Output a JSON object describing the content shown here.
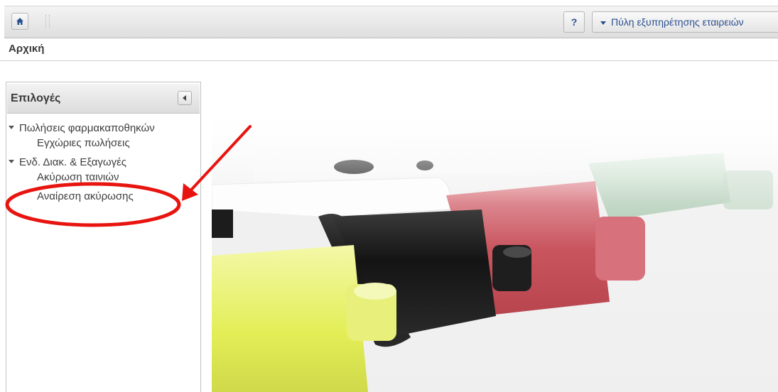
{
  "toolbar": {
    "home_icon": "home-icon",
    "help_label": "?",
    "portal_label": "Πύλη εξυπηρέτησης εταιρειών"
  },
  "breadcrumb": {
    "current": "Αρχική"
  },
  "sidebar": {
    "title": "Επιλογές",
    "collapse_icon": "collapse-left-icon",
    "groups": [
      {
        "label": "Πωλήσεις φαρμακαποθηκών",
        "items": [
          {
            "label": "Εγχώριες πωλήσεις"
          }
        ]
      },
      {
        "label": "Ενδ. Διακ. & Εξαγωγές",
        "items": [
          {
            "label": "Ακύρωση ταινιών"
          },
          {
            "label": "Αναίρεση ακύρωσης"
          }
        ]
      }
    ]
  },
  "hero": {
    "image": "highlighter-markers-photo"
  },
  "annotation": {
    "color": "#e8140f"
  }
}
